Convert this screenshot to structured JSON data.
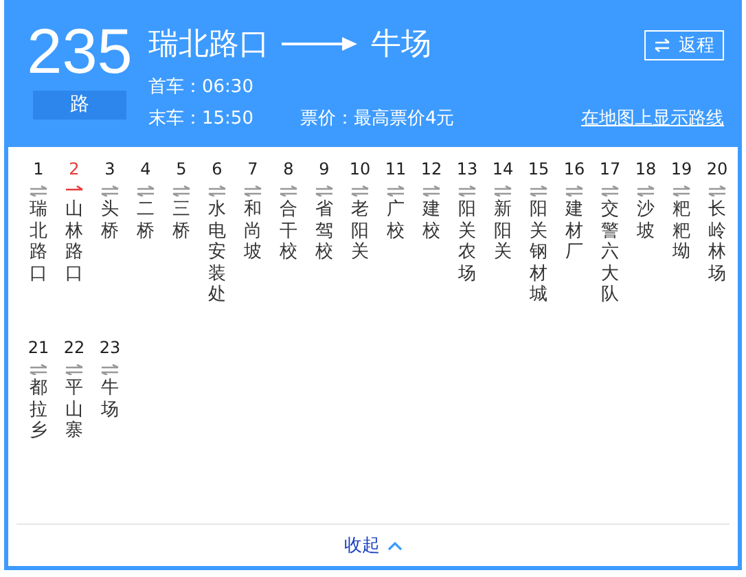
{
  "route": {
    "number": "235",
    "suffix": "路",
    "origin": "瑞北路口",
    "destination": "牛场",
    "first_bus": "首车：06:30",
    "last_bus": "末车：15:50",
    "fare": "票价：最高票价4元",
    "return_button": "返程",
    "map_link": "在地图上显示路线"
  },
  "stops": [
    {
      "index": "1",
      "name": "瑞北路口",
      "selected": false
    },
    {
      "index": "2",
      "name": "山林路口",
      "selected": true
    },
    {
      "index": "3",
      "name": "头桥",
      "selected": false
    },
    {
      "index": "4",
      "name": "二桥",
      "selected": false
    },
    {
      "index": "5",
      "name": "三桥",
      "selected": false
    },
    {
      "index": "6",
      "name": "水电安装处",
      "selected": false
    },
    {
      "index": "7",
      "name": "和尚坡",
      "selected": false
    },
    {
      "index": "8",
      "name": "合干校",
      "selected": false
    },
    {
      "index": "9",
      "name": "省驾校",
      "selected": false
    },
    {
      "index": "10",
      "name": "老阳关",
      "selected": false
    },
    {
      "index": "11",
      "name": "广校",
      "selected": false
    },
    {
      "index": "12",
      "name": "建校",
      "selected": false
    },
    {
      "index": "13",
      "name": "阳关农场",
      "selected": false
    },
    {
      "index": "14",
      "name": "新阳关",
      "selected": false
    },
    {
      "index": "15",
      "name": "阳关钢材城",
      "selected": false
    },
    {
      "index": "16",
      "name": "建材厂",
      "selected": false
    },
    {
      "index": "17",
      "name": "交警六大队",
      "selected": false
    },
    {
      "index": "18",
      "name": "沙坡",
      "selected": false
    },
    {
      "index": "19",
      "name": "粑粑坳",
      "selected": false
    },
    {
      "index": "20",
      "name": "长岭林场",
      "selected": false
    },
    {
      "index": "21",
      "name": "都拉乡",
      "selected": false
    },
    {
      "index": "22",
      "name": "平山寨",
      "selected": false
    },
    {
      "index": "23",
      "name": "牛场",
      "selected": false
    }
  ],
  "collapse_link": "收起"
}
